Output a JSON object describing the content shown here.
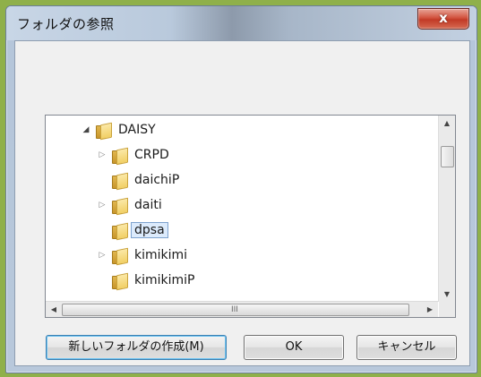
{
  "window": {
    "title": "フォルダの参照",
    "close_label": "x"
  },
  "tree": {
    "items": [
      {
        "label": "DAISY",
        "level": 0,
        "expander": "open",
        "selected": false
      },
      {
        "label": "CRPD",
        "level": 1,
        "expander": "collapsed",
        "selected": false
      },
      {
        "label": "daichiP",
        "level": 1,
        "expander": "none",
        "selected": false
      },
      {
        "label": "daiti",
        "level": 1,
        "expander": "collapsed",
        "selected": false
      },
      {
        "label": "dpsa",
        "level": 1,
        "expander": "none",
        "selected": true
      },
      {
        "label": "kimikimi",
        "level": 1,
        "expander": "collapsed",
        "selected": false
      },
      {
        "label": "kimikimiP",
        "level": 1,
        "expander": "none",
        "selected": false
      }
    ],
    "hscroll_grip": "III"
  },
  "buttons": {
    "new_folder_label": "新しいフォルダの作成(M)",
    "ok_label": "OK",
    "cancel_label": "キャンセル"
  },
  "colors": {
    "selection_bg": "#dcebfc",
    "selection_border": "#7da2ce",
    "close_button": "#c23a26",
    "frame_outer": "#8fb04a"
  }
}
